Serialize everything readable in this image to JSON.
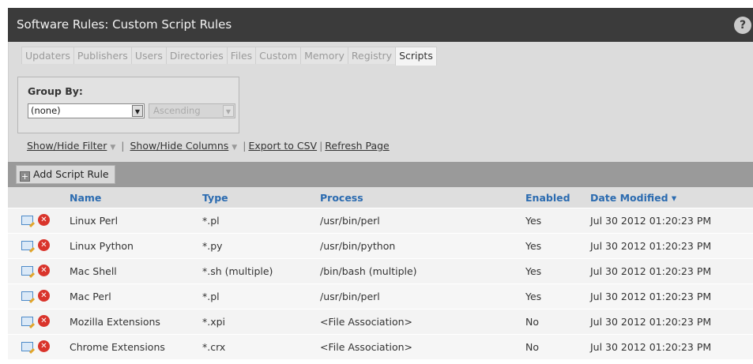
{
  "window": {
    "title": "Software Rules: Custom Script Rules",
    "help": "?"
  },
  "tabs": [
    {
      "label": "Updaters",
      "active": false
    },
    {
      "label": "Publishers",
      "active": false
    },
    {
      "label": "Users",
      "active": false
    },
    {
      "label": "Directories",
      "active": false
    },
    {
      "label": "Files",
      "active": false
    },
    {
      "label": "Custom",
      "active": false
    },
    {
      "label": "Memory",
      "active": false
    },
    {
      "label": "Registry",
      "active": false
    },
    {
      "label": "Scripts",
      "active": true
    }
  ],
  "group_by": {
    "label": "Group By:",
    "value": "(none)",
    "order": "Ascending"
  },
  "actions": {
    "show_hide_filter": "Show/Hide Filter",
    "show_hide_columns": "Show/Hide Columns",
    "export_csv": "Export to CSV",
    "refresh": "Refresh Page"
  },
  "toolbar": {
    "add_label": "Add Script Rule"
  },
  "table": {
    "columns": {
      "name": "Name",
      "type": "Type",
      "process": "Process",
      "enabled": "Enabled",
      "date": "Date Modified ▾"
    },
    "rows": [
      {
        "name": "Linux Perl",
        "type": "*.pl",
        "process": "/usr/bin/perl",
        "enabled": "Yes",
        "date": "Jul 30 2012 01:20:23 PM"
      },
      {
        "name": "Linux Python",
        "type": "*.py",
        "process": "/usr/bin/python",
        "enabled": "Yes",
        "date": "Jul 30 2012 01:20:23 PM"
      },
      {
        "name": "Mac Shell",
        "type": "*.sh (multiple)",
        "process": "/bin/bash (multiple)",
        "enabled": "Yes",
        "date": "Jul 30 2012 01:20:23 PM"
      },
      {
        "name": "Mac Perl",
        "type": "*.pl",
        "process": "/usr/bin/perl",
        "enabled": "Yes",
        "date": "Jul 30 2012 01:20:23 PM"
      },
      {
        "name": "Mozilla Extensions",
        "type": "*.xpi",
        "process": "<File Association>",
        "enabled": "No",
        "date": "Jul 30 2012 01:20:23 PM"
      },
      {
        "name": "Chrome Extensions",
        "type": "*.crx",
        "process": "<File Association>",
        "enabled": "No",
        "date": "Jul 30 2012 01:20:23 PM"
      }
    ]
  }
}
